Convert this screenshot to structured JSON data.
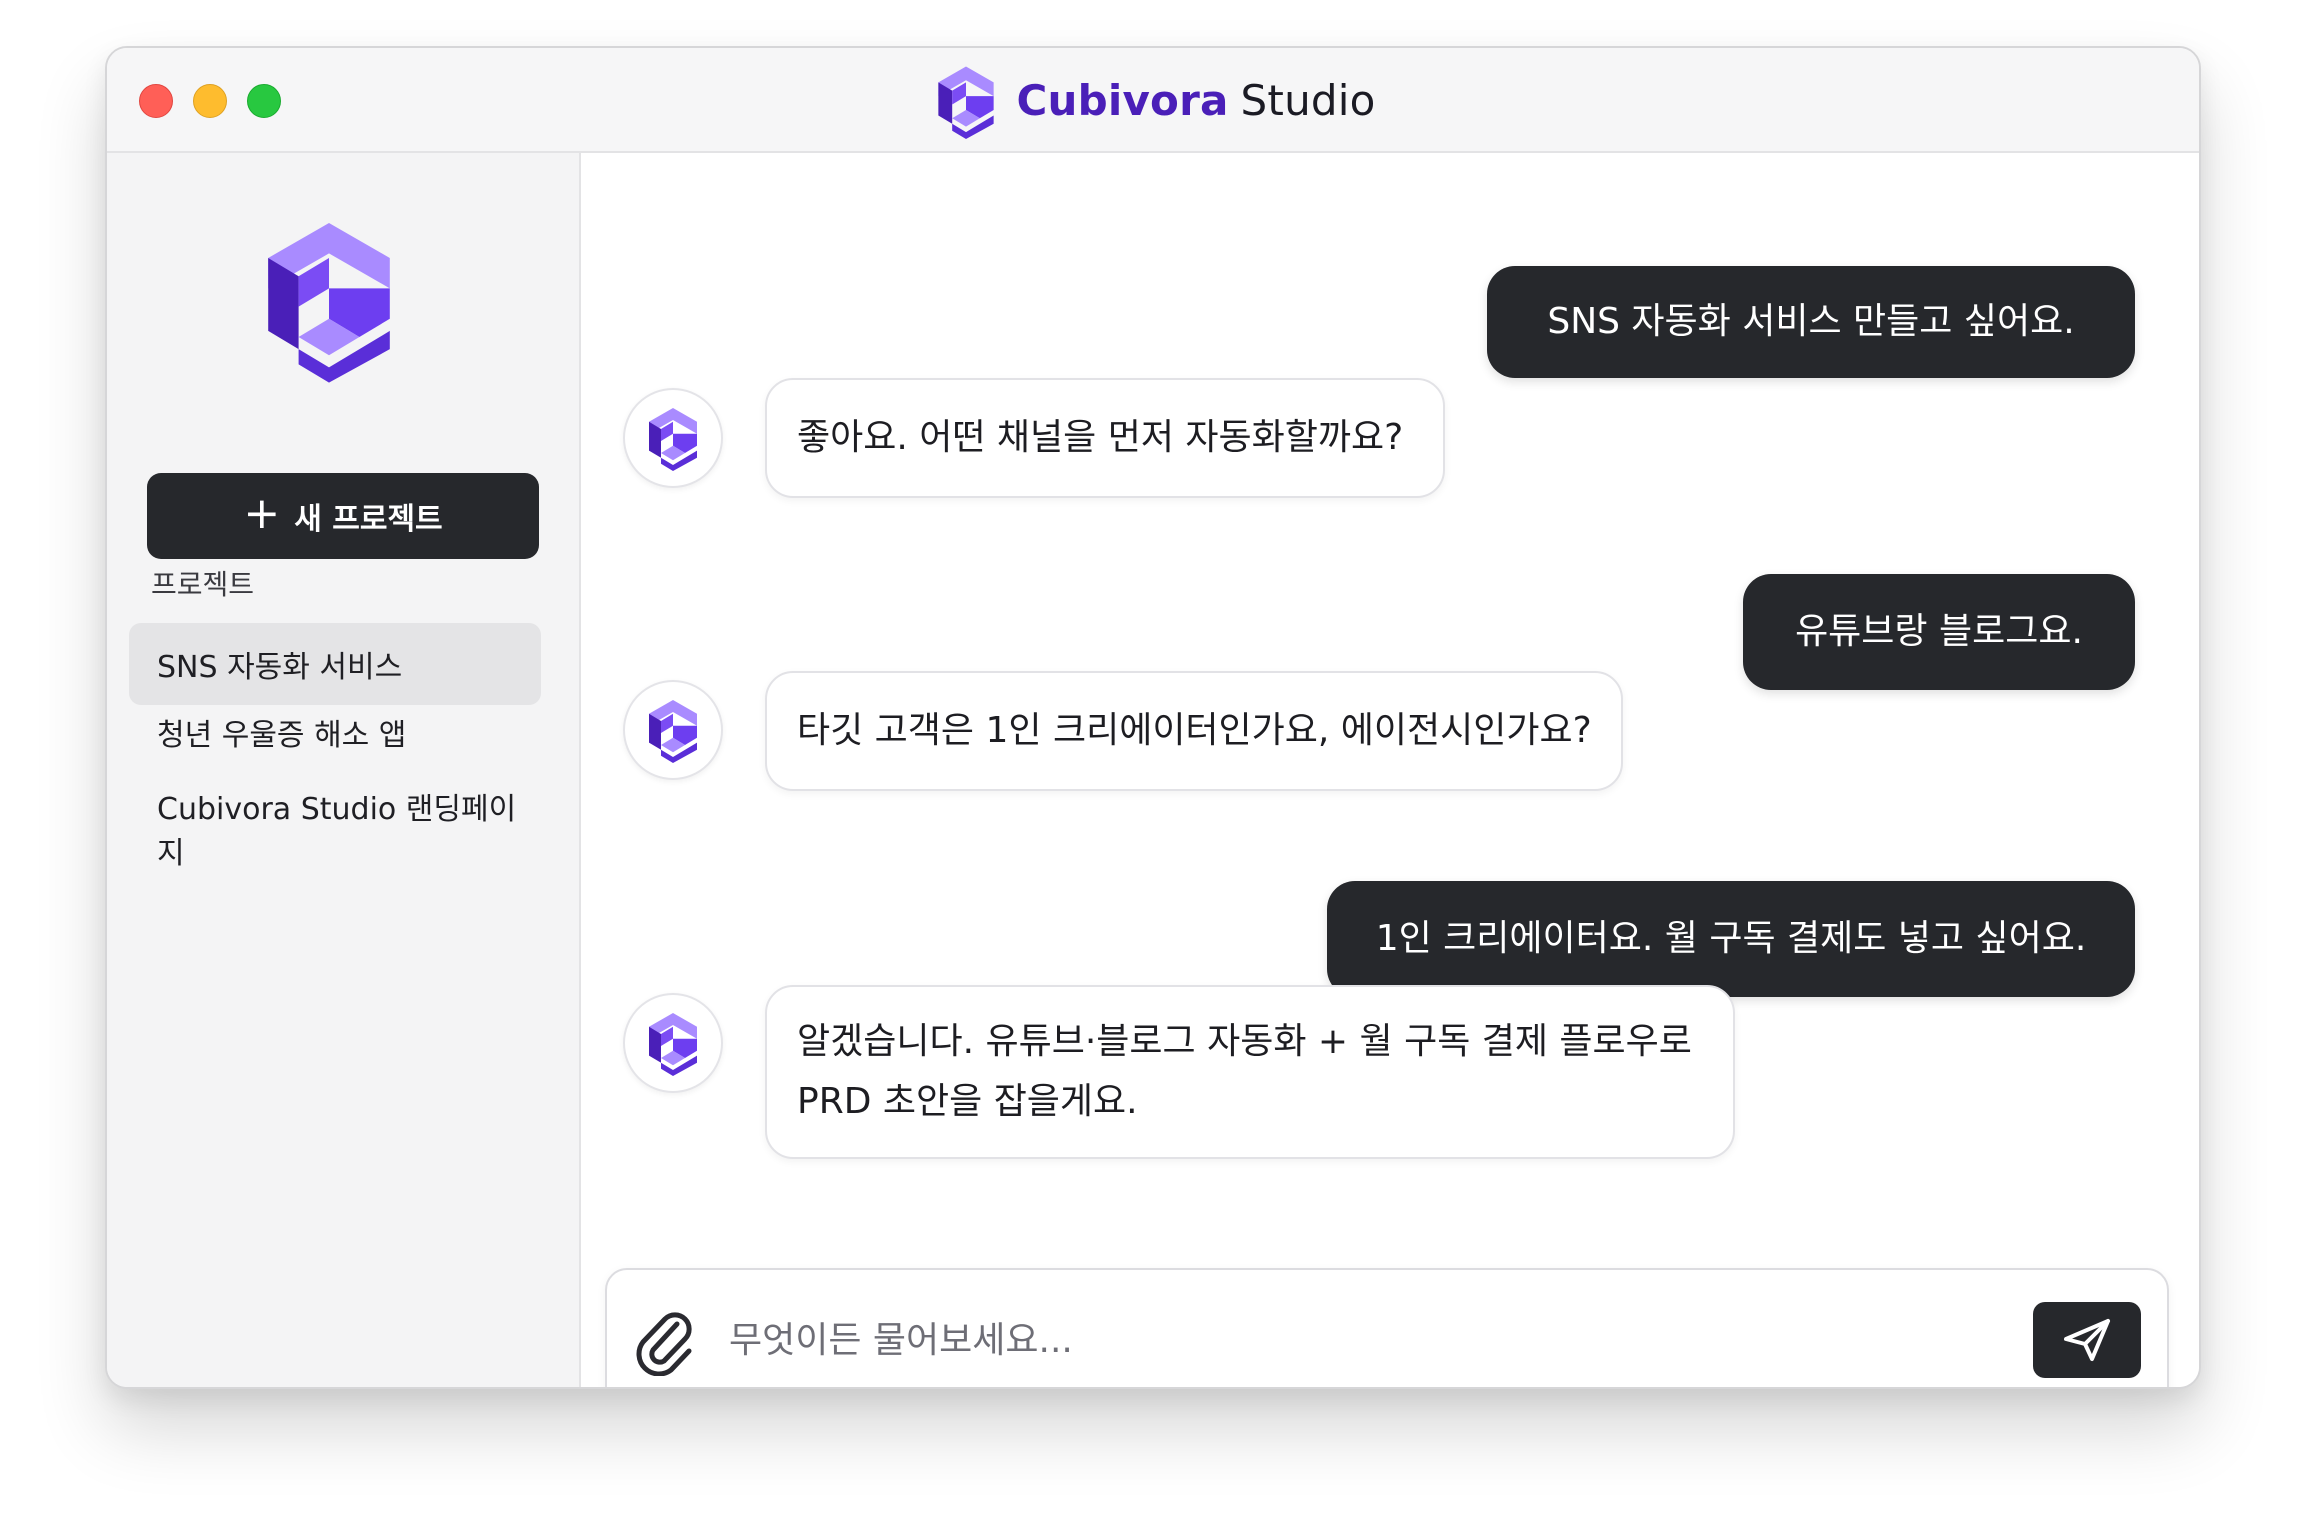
{
  "window": {
    "brand_name": "Cubivora",
    "brand_suffix": "Studio"
  },
  "sidebar": {
    "new_project_label": "새 프로젝트",
    "section_label": "프로젝트",
    "items": [
      {
        "label": "SNS 자동화 서비스",
        "active": true
      },
      {
        "label": "청년 우울증 해소 앱",
        "active": false
      },
      {
        "label": "Cubivora Studio 랜딩페이지",
        "active": false
      }
    ]
  },
  "chat": {
    "messages": [
      {
        "role": "user",
        "text": "SNS 자동화 서비스 만들고 싶어요."
      },
      {
        "role": "assistant",
        "text": "좋아요. 어떤 채널을 먼저 자동화할까요?"
      },
      {
        "role": "user",
        "text": "유튜브랑 블로그요."
      },
      {
        "role": "assistant",
        "text": "타깃 고객은 1인 크리에이터인가요, 에이전시인가요?"
      },
      {
        "role": "user",
        "text": "1인 크리에이터요. 월 구독 결제도 넣고 싶어요."
      },
      {
        "role": "assistant",
        "lines": [
          "알겠습니다. 유튜브·블로그 자동화 + 월 구독 결제 플로우로",
          "PRD 초안을 잡을게요."
        ]
      }
    ]
  },
  "composer": {
    "placeholder": "무엇이든 물어보세요..."
  },
  "colors": {
    "accent_dark": "#4a1fb8",
    "accent_mid": "#6d3ef0",
    "accent_light": "#a98bff",
    "bubble_user": "#26282c"
  }
}
